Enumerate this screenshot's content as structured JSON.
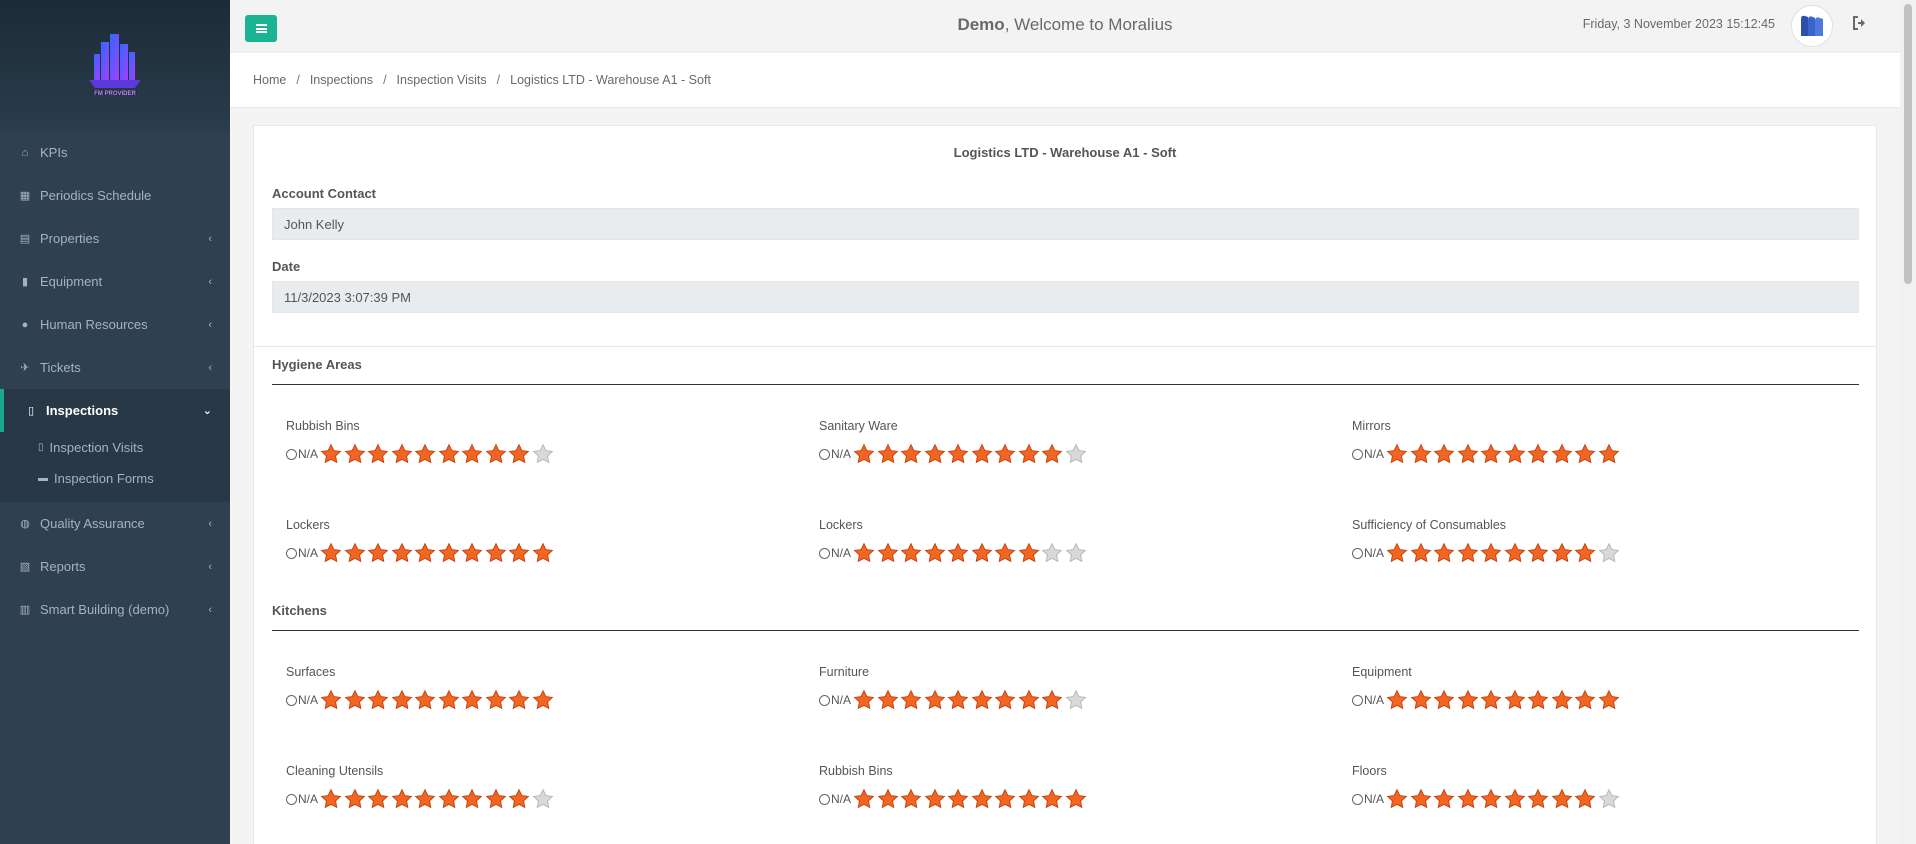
{
  "sidebar": {
    "logo_text": "FM PROVIDER",
    "items": [
      {
        "label": "KPIs",
        "icon": "home-icon",
        "chevron": false
      },
      {
        "label": "Periodics Schedule",
        "icon": "calendar-icon",
        "chevron": false
      },
      {
        "label": "Properties",
        "icon": "building-icon",
        "chevron": true
      },
      {
        "label": "Equipment",
        "icon": "book-icon",
        "chevron": true
      },
      {
        "label": "Human Resources",
        "icon": "users-icon",
        "chevron": true
      },
      {
        "label": "Tickets",
        "icon": "ticket-icon",
        "chevron": true
      },
      {
        "label": "Inspections",
        "icon": "inspection-icon",
        "chevron": true,
        "active": true
      },
      {
        "label": "Quality Assurance",
        "icon": "search-icon",
        "chevron": true
      },
      {
        "label": "Reports",
        "icon": "reports-icon",
        "chevron": true
      },
      {
        "label": "Smart Building (demo)",
        "icon": "chart-icon",
        "chevron": true
      }
    ],
    "sub_items": [
      {
        "label": "Inspection Visits",
        "icon": "map-icon"
      },
      {
        "label": "Inspection Forms",
        "icon": "folder-icon"
      }
    ]
  },
  "topbar": {
    "user": "Demo",
    "welcome_rest": ", Welcome to Moralius",
    "datetime": "Friday, 3 November 2023 15:12:45"
  },
  "breadcrumb": [
    "Home",
    "Inspections",
    "Inspection Visits",
    "Logistics LTD - Warehouse A1 - Soft"
  ],
  "form": {
    "title": "Logistics LTD - Warehouse A1 - Soft",
    "account_contact_label": "Account Contact",
    "account_contact_value": "John Kelly",
    "date_label": "Date",
    "date_value": "11/3/2023 3:07:39 PM"
  },
  "na_label": "N/A",
  "colors": {
    "accent": "#1ab394",
    "sidebar": "#2f4050",
    "star_on": "#f26522",
    "star_off": "#d9d9d9"
  },
  "sections": [
    {
      "title": "Hygiene Areas",
      "items": [
        {
          "label": "Rubbish Bins",
          "rating": 9,
          "max": 10
        },
        {
          "label": "Sanitary Ware",
          "rating": 9,
          "max": 10
        },
        {
          "label": "Mirrors",
          "rating": 10,
          "max": 10
        },
        {
          "label": "Lockers",
          "rating": 10,
          "max": 10
        },
        {
          "label": "Lockers",
          "rating": 8,
          "max": 10
        },
        {
          "label": "Sufficiency of Consumables",
          "rating": 9,
          "max": 10
        }
      ]
    },
    {
      "title": "Kitchens",
      "items": [
        {
          "label": "Surfaces",
          "rating": 10,
          "max": 10
        },
        {
          "label": "Furniture",
          "rating": 9,
          "max": 10
        },
        {
          "label": "Equipment",
          "rating": 10,
          "max": 10
        },
        {
          "label": "Cleaning Utensils",
          "rating": 9,
          "max": 10
        },
        {
          "label": "Rubbish Bins",
          "rating": 10,
          "max": 10
        },
        {
          "label": "Floors",
          "rating": 9,
          "max": 10
        }
      ]
    }
  ]
}
